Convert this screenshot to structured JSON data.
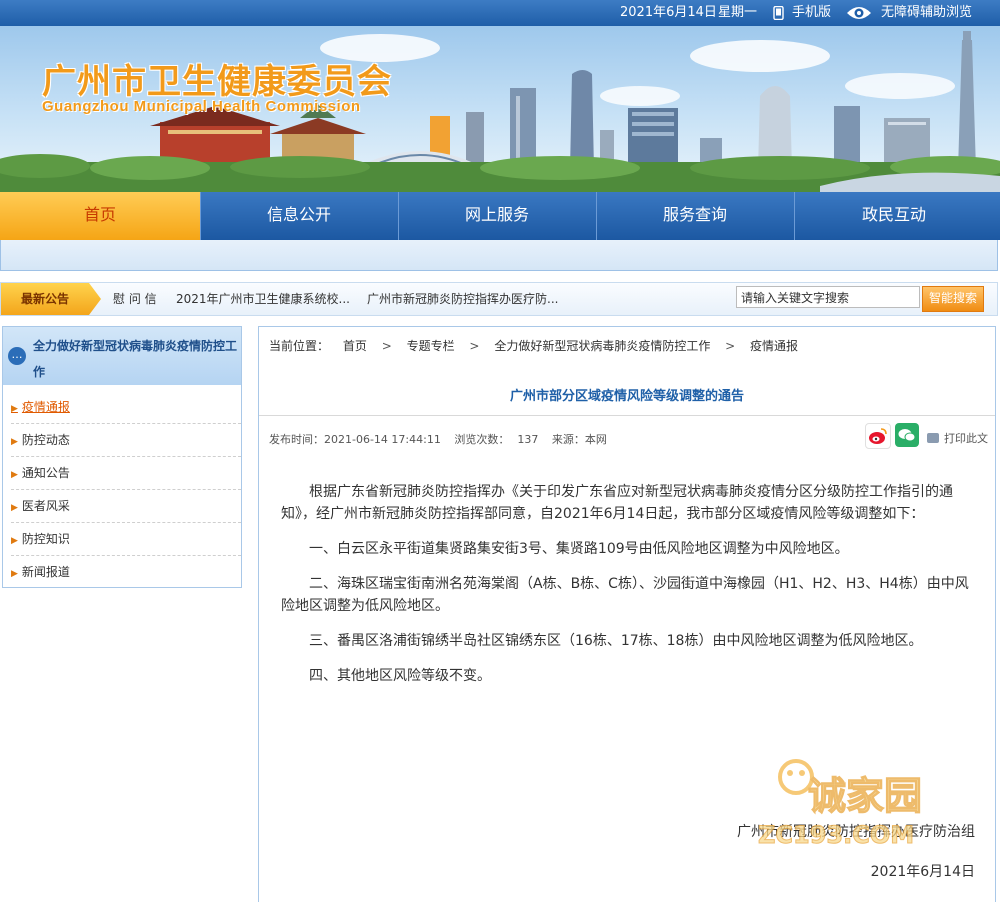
{
  "topbar": {
    "date": "2021年6月14日",
    "weekday": "星期一",
    "mobile_label": "手机版",
    "accessibility_label": "无障碍辅助浏览"
  },
  "banner": {
    "logo_cn": "广州市卫生健康委员会",
    "logo_en": "Guangzhou Municipal Health Commission"
  },
  "nav": {
    "items": [
      "首页",
      "信息公开",
      "网上服务",
      "服务查询",
      "政民互动"
    ]
  },
  "notice": {
    "tag": "最新公告",
    "items": [
      "慰 问 信",
      "2021年广州市卫生健康系统校...",
      "广州市新冠肺炎防控指挥办医疗防..."
    ]
  },
  "search": {
    "value": "请输入关键文字搜索",
    "button": "智能搜索"
  },
  "sidebar": {
    "title": "全力做好新型冠状病毒肺炎疫情防控工作",
    "items": [
      "疫情通报",
      "防控动态",
      "通知公告",
      "医者风采",
      "防控知识",
      "新闻报道"
    ]
  },
  "breadcrumb": {
    "label": "当前位置：",
    "items": [
      "首页",
      "专题专栏",
      "全力做好新型冠状病毒肺炎疫情防控工作",
      "疫情通报"
    ],
    "separator": ">"
  },
  "article": {
    "title": "广州市部分区域疫情风险等级调整的通告",
    "publish_label": "发布时间：",
    "publish_time": "2021-06-14 17:44:11",
    "views_label": "浏览次数：",
    "views": "137",
    "source_label": "来源：本网",
    "print_label": "打印此文",
    "paragraphs": [
      "根据广东省新冠肺炎防控指挥办《关于印发广东省应对新型冠状病毒肺炎疫情分区分级防控工作指引的通知》，经广州市新冠肺炎防控指挥部同意，自2021年6月14日起，我市部分区域疫情风险等级调整如下：",
      "一、白云区永平街道集贤路集安街3号、集贤路109号由低风险地区调整为中风险地区。",
      "二、海珠区瑞宝街南洲名苑海棠阁（A栋、B栋、C栋）、沙园街道中海橡园（H1、H2、H3、H4栋）由中风险地区调整为低风险地区。",
      "三、番禺区洛浦街锦绣半岛社区锦绣东区（16栋、17栋、18栋）由中风险地区调整为低风险地区。",
      "四、其他地区风险等级不变。"
    ],
    "signature": "广州市新冠肺炎防控指挥办医疗防治组",
    "date": "2021年6月14日"
  },
  "watermark": {
    "cn": "诚家园",
    "url": "ZC193.COM"
  },
  "colors": {
    "brand_blue": "#1f5ea8",
    "accent_orange": "#f29a1a",
    "link_blue": "#1f60a8"
  }
}
